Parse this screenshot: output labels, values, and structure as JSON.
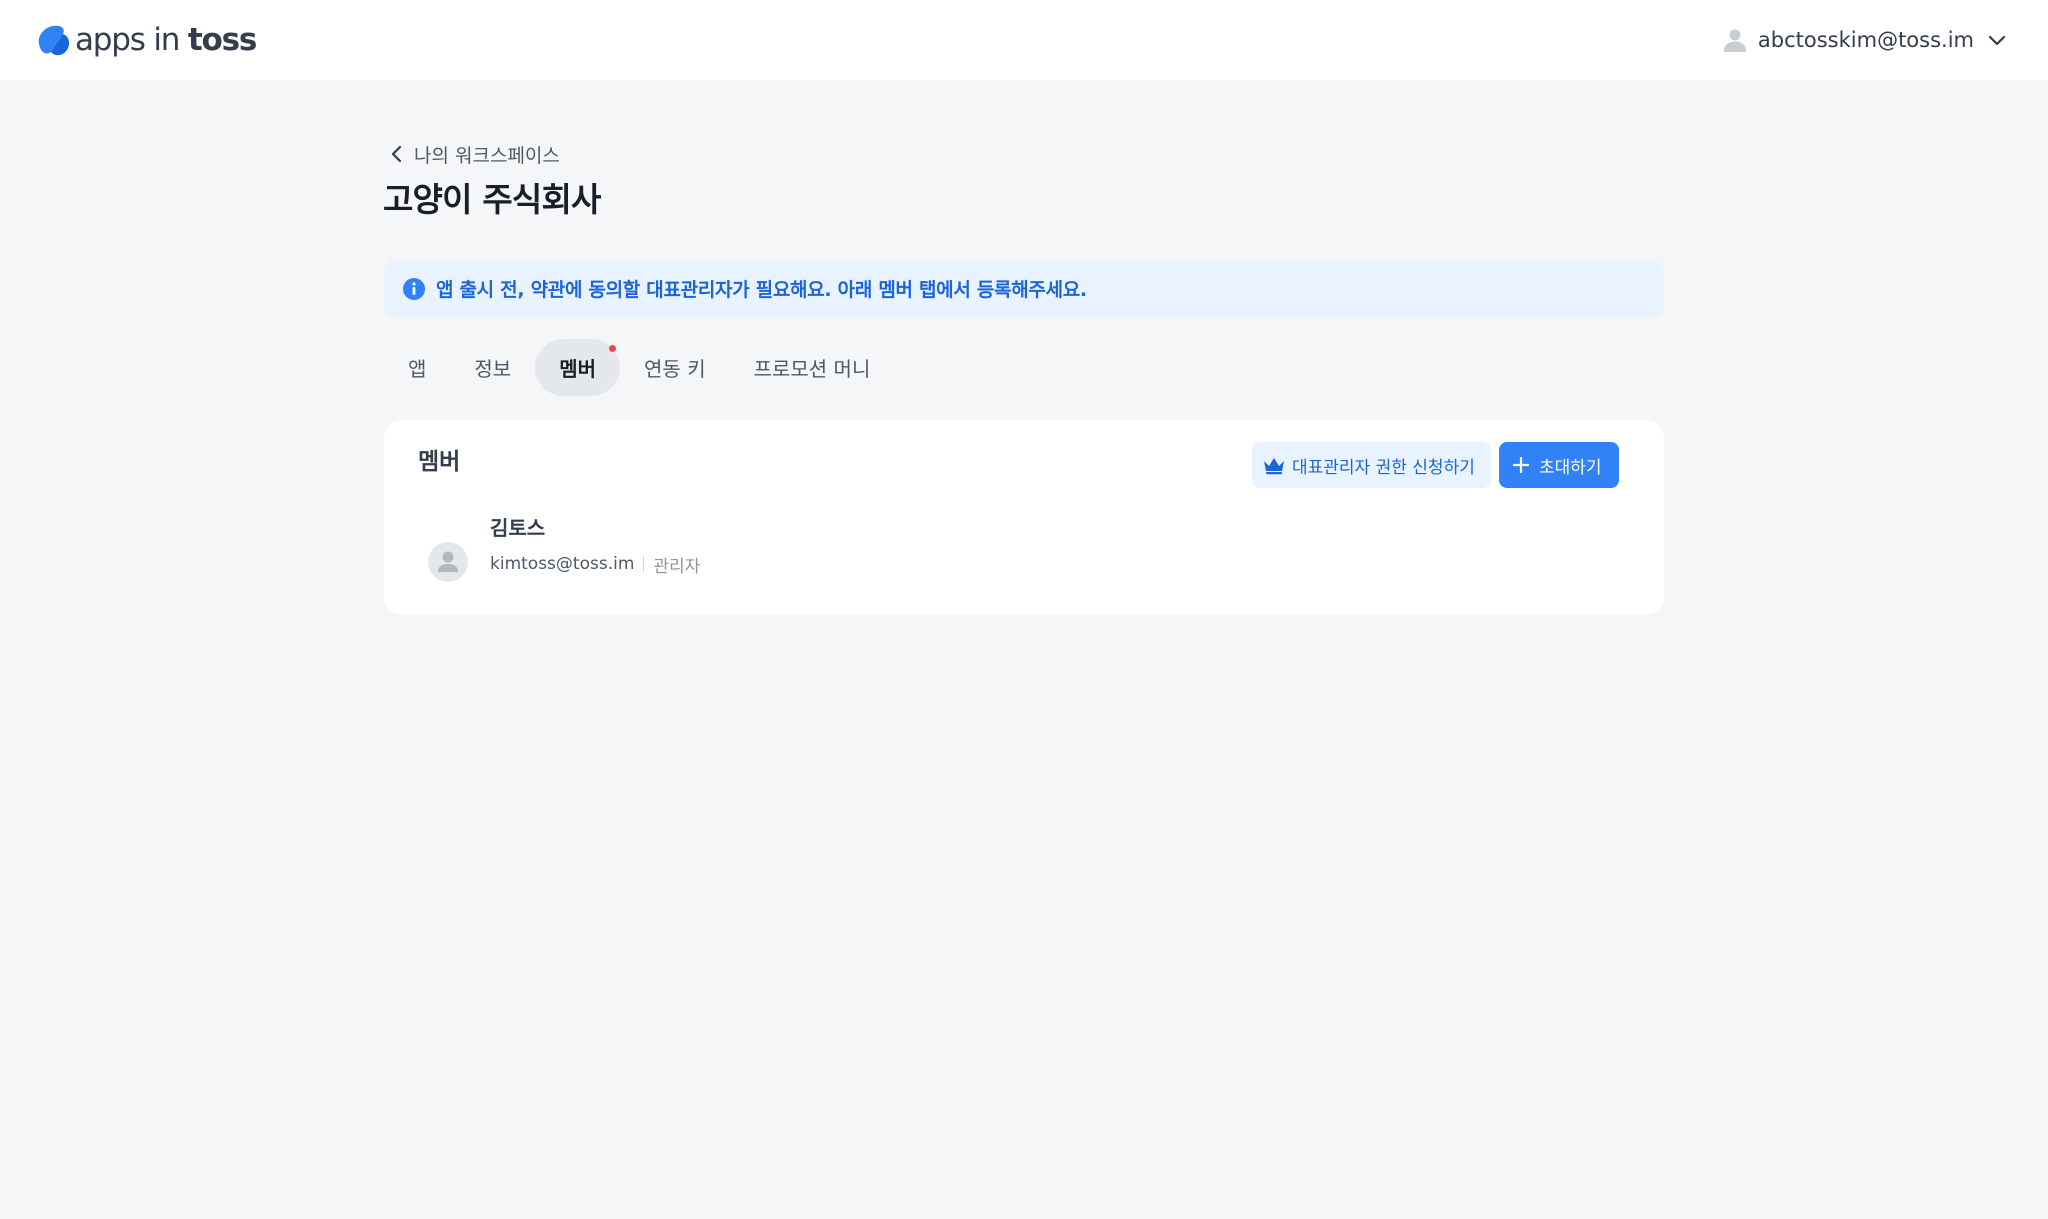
{
  "header": {
    "logo": {
      "light": "apps in ",
      "bold": "toss"
    },
    "account_email": "abctosskim@toss.im"
  },
  "breadcrumb": {
    "label": "나의 워크스페이스"
  },
  "page": {
    "title": "고양이 주식회사"
  },
  "notice": {
    "text": "앱 출시 전, 약관에 동의할 대표관리자가 필요해요. 아래 멤버 탭에서 등록해주세요."
  },
  "tabs": [
    {
      "label": "앱"
    },
    {
      "label": "정보"
    },
    {
      "label": "멤버"
    },
    {
      "label": "연동 키"
    },
    {
      "label": "프로모션 머니"
    }
  ],
  "active_tab": "멤버",
  "members_card": {
    "title": "멤버",
    "apply_button": "대표관리자 권한 신청하기",
    "invite_button": "초대하기",
    "members": [
      {
        "name": "김토스",
        "email": "kimtoss@toss.im",
        "role": "관리자"
      }
    ]
  },
  "colors": {
    "primary": "#3182f6",
    "notice_bg": "#e8f3ff",
    "notice_text": "#1b64da",
    "background": "#f4f6f8",
    "badge_dot": "#f04452"
  }
}
